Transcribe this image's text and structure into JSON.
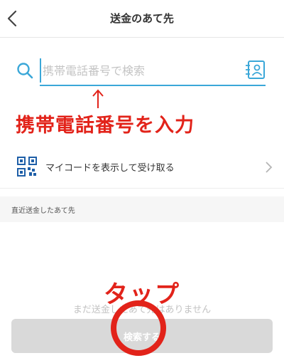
{
  "header": {
    "title": "送金のあて先",
    "back_icon": "chevron-left-icon"
  },
  "search": {
    "placeholder": "携帯電話番号で検索",
    "value": "",
    "search_icon": "search-icon",
    "contacts_icon": "contacts-icon",
    "accent_color": "#3aa7d8"
  },
  "annotation": {
    "arrow": "↑",
    "instruction": "携帯電話番号を入力",
    "tap": "タップ",
    "color": "#e2231a"
  },
  "my_code_row": {
    "label": "マイコードを表示して受け取る",
    "icon": "qr-code-icon"
  },
  "recent_section": {
    "label": "直近送金したあて先"
  },
  "footer": {
    "faded_text": "まだ送金したあて先はありません",
    "search_button_label": "検索する"
  }
}
